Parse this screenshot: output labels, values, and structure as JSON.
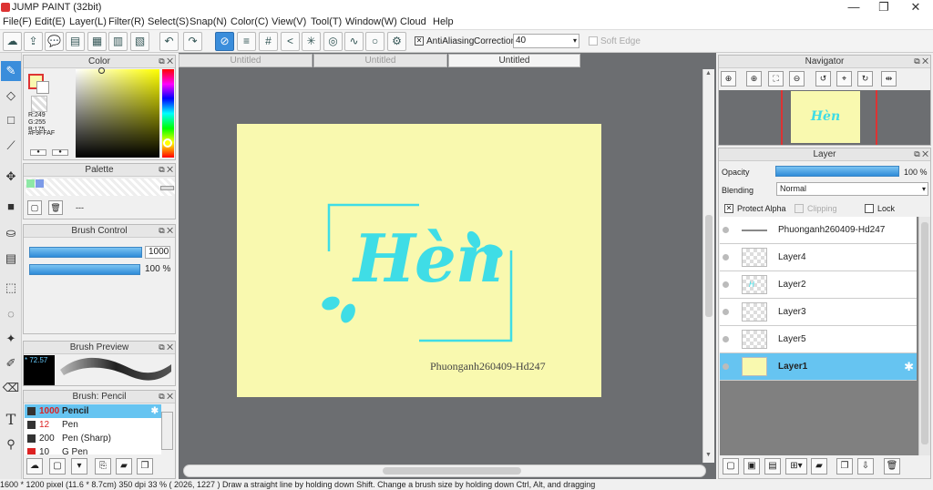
{
  "window": {
    "title": "JUMP PAINT (32bit)"
  },
  "menu": [
    "File(F)",
    "Edit(E)",
    "Layer(L)",
    "Filter(R)",
    "Select(S)",
    "Snap(N)",
    "Color(C)",
    "View(V)",
    "Tool(T)",
    "Window(W)",
    "Cloud",
    "Help"
  ],
  "toolbar": {
    "antialiasing_label": "AntiAliasing",
    "correction_label": "Correction",
    "correction_value": "40",
    "soft_edge_label": "Soft Edge"
  },
  "color_panel": {
    "title": "Color",
    "r": "R:249",
    "g": "G:255",
    "b": "B:175",
    "hex": "#F9FFAF",
    "current_color": "#f9f9af",
    "secondary_color": "#ffffff"
  },
  "palette_panel": {
    "title": "Palette",
    "swatches": [
      "#8ee8a6",
      "#7d9be8"
    ],
    "dash": "---"
  },
  "brush_control": {
    "title": "Brush Control",
    "size_value": "1000",
    "opacity_value": "100 %"
  },
  "brush_preview": {
    "title": "Brush Preview",
    "size_label": "* 72.57"
  },
  "brush_list": {
    "title": "Brush: Pencil",
    "items": [
      {
        "size": "1000",
        "name": "Pencil",
        "selected": true
      },
      {
        "size": "12",
        "name": "Pen"
      },
      {
        "size": "200",
        "name": "Pen (Sharp)"
      },
      {
        "size": "10",
        "name": "G Pen"
      }
    ]
  },
  "tabs": [
    "Untitled",
    "Untitled",
    "Untitled"
  ],
  "artwork": {
    "main_text": "Hèn",
    "signature": "Phuonganh260409-Hd247",
    "background": "#f9f9af",
    "accent": "#3fdde6"
  },
  "navigator": {
    "title": "Navigator",
    "thumb_text": "Hèn"
  },
  "layer_panel": {
    "title": "Layer",
    "opacity_label": "Opacity",
    "opacity_value": "100 %",
    "blending_label": "Blending",
    "blending_value": "Normal",
    "protect_alpha_label": "Protect Alpha",
    "clipping_label": "Clipping",
    "lock_label": "Lock",
    "layers": [
      {
        "name": "Phuonganh260409-Hd247"
      },
      {
        "name": "Layer4"
      },
      {
        "name": "Layer2"
      },
      {
        "name": "Layer3"
      },
      {
        "name": "Layer5"
      },
      {
        "name": "Layer1",
        "selected": true
      }
    ]
  },
  "status": {
    "text": "1600 * 1200 pixel   (11.6 * 8.7cm)   350 dpi   33 %   ( 2026, 1227 )   Draw a straight line by holding down Shift. Change a brush size by holding down Ctrl, Alt, and dragging"
  }
}
